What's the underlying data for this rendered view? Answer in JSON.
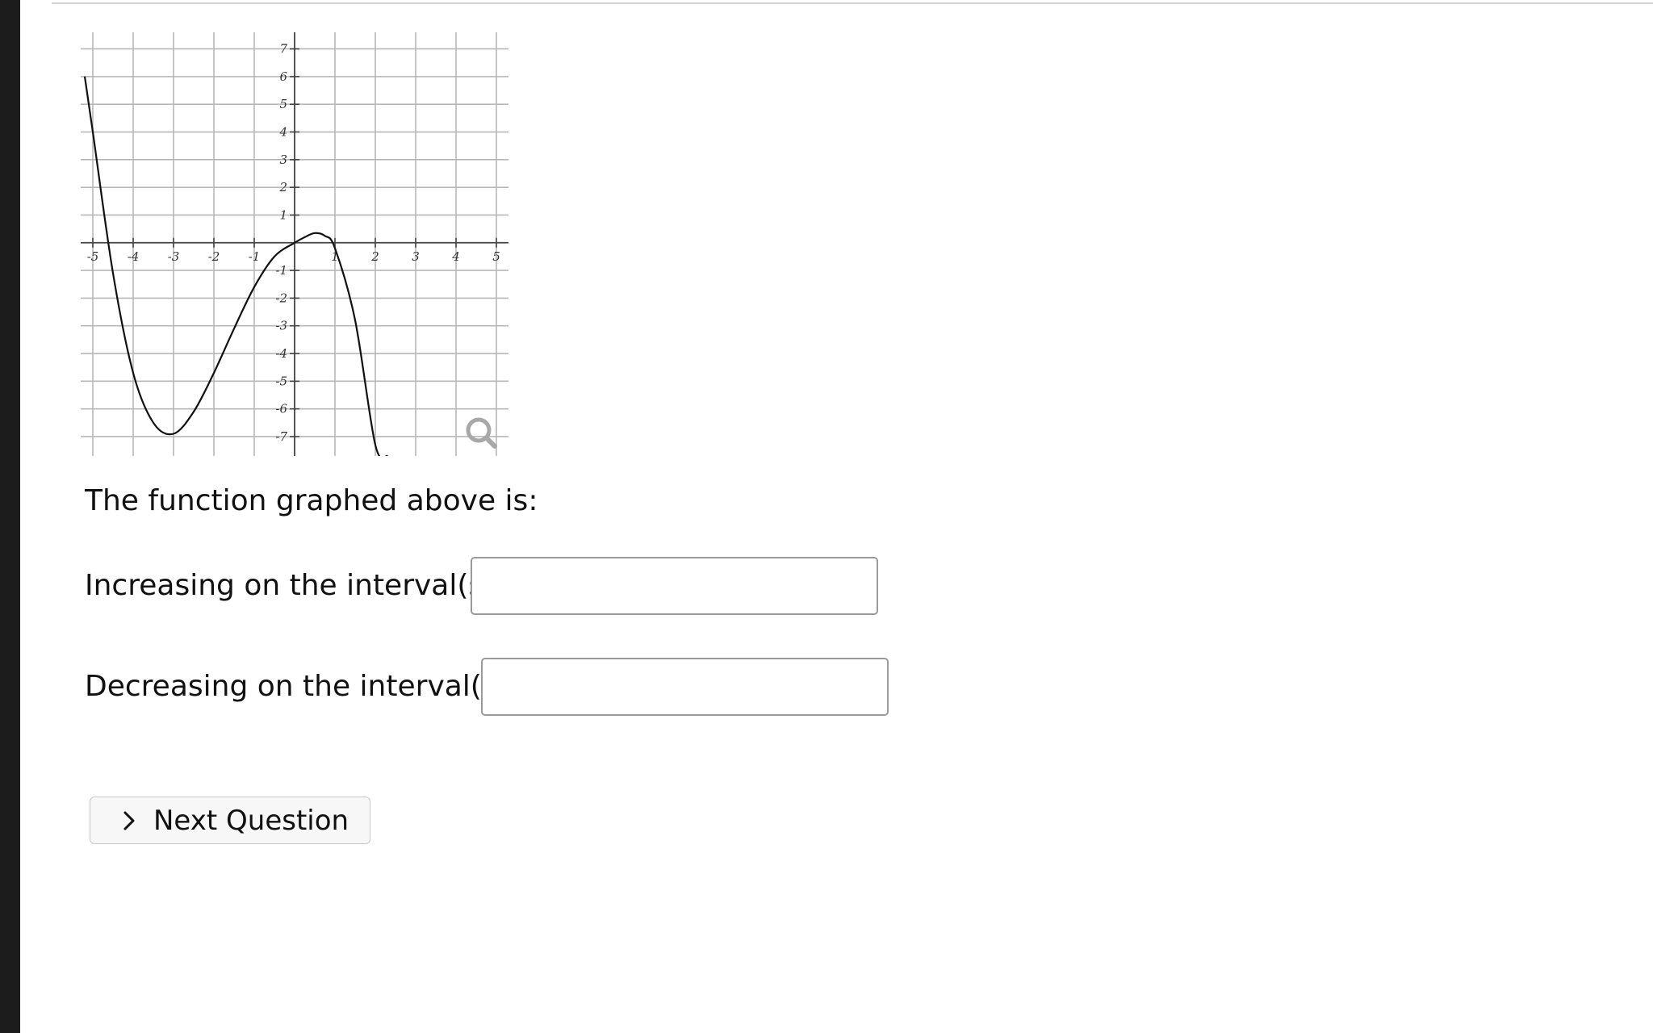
{
  "question": {
    "prompt": "The function graphed above is:",
    "increasing_label": "Increasing on the interval(s)",
    "increasing_value": "",
    "decreasing_label": "Decreasing on the interval(s)",
    "decreasing_value": ""
  },
  "actions": {
    "next_label": "Next Question",
    "next_icon": "chevron-right-icon",
    "zoom_icon": "magnifier-icon"
  },
  "chart_data": {
    "type": "line",
    "title": "",
    "xlabel": "",
    "ylabel": "",
    "xlim": [
      -5.3,
      5.3
    ],
    "ylim": [
      -7.7,
      7.6
    ],
    "grid": true,
    "x_ticks": [
      -5,
      -4,
      -3,
      -2,
      -1,
      1,
      2,
      3,
      4,
      5
    ],
    "x_tick_labels": [
      "-5",
      "-4",
      "-3",
      "-2",
      "-1",
      "1",
      "2",
      "3",
      "4",
      "5"
    ],
    "y_ticks": [
      -7,
      -6,
      -5,
      -4,
      -3,
      -2,
      -1,
      1,
      2,
      3,
      4,
      5,
      6,
      7
    ],
    "y_tick_labels": [
      "-7",
      "-6",
      "-5",
      "-4",
      "-3",
      "-2",
      "-1",
      "1",
      "2",
      "3",
      "4",
      "5",
      "6",
      "7"
    ],
    "series": [
      {
        "x": [
          -5.2,
          -5,
          -4.5,
          -4,
          -3.5,
          -3,
          -2.5,
          -2,
          -1.5,
          -1,
          -0.5,
          0,
          0.25,
          0.5,
          0.75,
          1,
          1.5,
          2,
          2.3
        ],
        "y": [
          6.0,
          4.0,
          -1.1,
          -4.7,
          -6.5,
          -6.9,
          -6.1,
          -4.7,
          -3.1,
          -1.6,
          -0.5,
          0.0,
          0.2,
          0.35,
          0.25,
          -0.2,
          -2.8,
          -7.3,
          -7.7
        ]
      }
    ]
  }
}
